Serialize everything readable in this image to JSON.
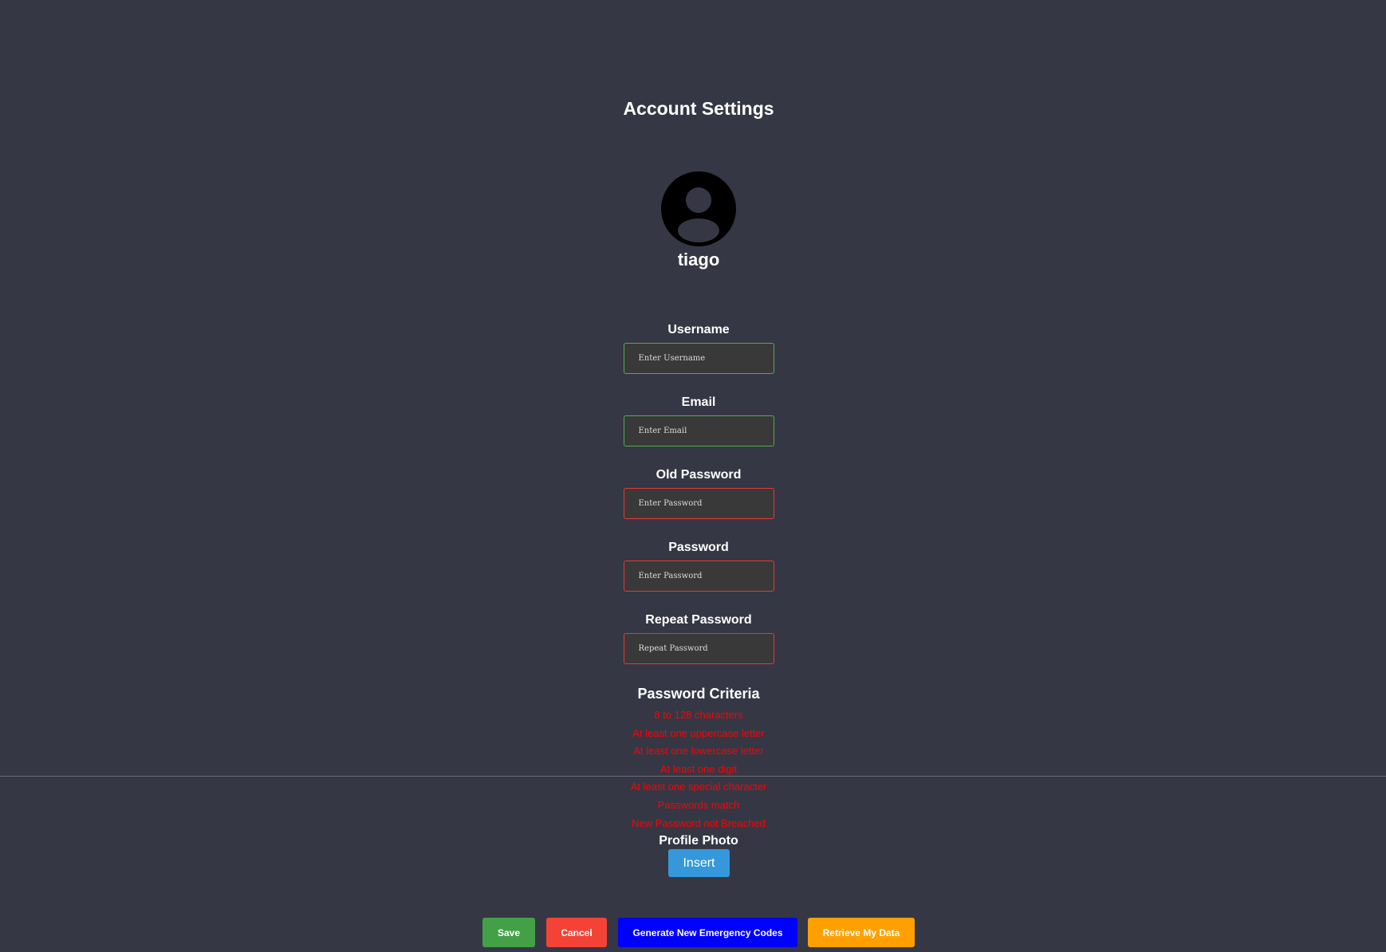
{
  "page": {
    "title": "Account Settings"
  },
  "profile": {
    "avatar_icon": "user-avatar-icon",
    "username": "tiago"
  },
  "form": {
    "username": {
      "label": "Username",
      "placeholder": "Enter Username",
      "value": "",
      "status": "valid"
    },
    "email": {
      "label": "Email",
      "placeholder": "Enter Email",
      "value": "",
      "status": "valid"
    },
    "old_password": {
      "label": "Old Password",
      "placeholder": "Enter Password",
      "value": "",
      "status": "invalid"
    },
    "password": {
      "label": "Password",
      "placeholder": "Enter Password",
      "value": "",
      "status": "invalid"
    },
    "repeat_password": {
      "label": "Repeat Password",
      "placeholder": "Repeat Password",
      "value": "",
      "status": "invalid"
    }
  },
  "criteria": {
    "title": "Password Criteria",
    "items": [
      "8 to 128 characters",
      "At least one uppercase letter",
      "At least one lowercase letter",
      "At least one digit",
      "At least one special character",
      "Passwords match",
      "New Password not Breached"
    ]
  },
  "photo": {
    "label": "Profile Photo",
    "insert_label": "Insert"
  },
  "actions": {
    "save": "Save",
    "cancel": "Cancel",
    "emergency": "Generate New Emergency Codes",
    "retrieve": "Retrieve My Data"
  },
  "colors": {
    "background": "#363744",
    "valid_border": "#4caf50",
    "invalid_border": "#e53935",
    "criteria_text": "#ff0000",
    "insert_button": "#3498db",
    "save_button": "#43a047",
    "cancel_button": "#f44336",
    "emergency_button": "#0000ff",
    "retrieve_button": "#ffa000"
  }
}
